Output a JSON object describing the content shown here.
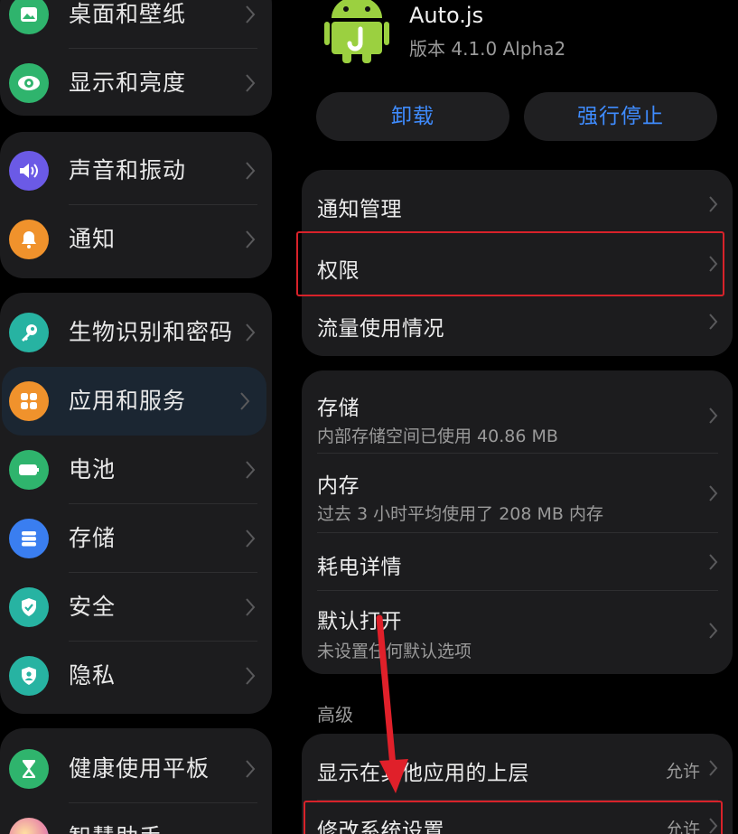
{
  "left_menu": {
    "items": [
      {
        "label": "桌面和壁纸",
        "icon": "wallpaper-icon",
        "color": "#2fb46d"
      },
      {
        "label": "显示和亮度",
        "icon": "eye-icon",
        "color": "#2fb46d"
      },
      {
        "label": "声音和振动",
        "icon": "speaker-icon",
        "color": "#6b5ae6"
      },
      {
        "label": "通知",
        "icon": "bell-icon",
        "color": "#f0922c"
      },
      {
        "label": "生物识别和密码",
        "icon": "key-icon",
        "color": "#27b3a2"
      },
      {
        "label": "应用和服务",
        "icon": "apps-icon",
        "color": "#f0922c"
      },
      {
        "label": "电池",
        "icon": "battery-icon",
        "color": "#2fb46d"
      },
      {
        "label": "存储",
        "icon": "storage-icon",
        "color": "#3a7ef0"
      },
      {
        "label": "安全",
        "icon": "shield-check-icon",
        "color": "#27b3a2"
      },
      {
        "label": "隐私",
        "icon": "privacy-icon",
        "color": "#27b3a2"
      },
      {
        "label": "健康使用平板",
        "icon": "hourglass-icon",
        "color": "#2fb46d"
      },
      {
        "label": "智慧助手",
        "icon": "assistant-icon",
        "color": "#e98aa8"
      }
    ],
    "selected_index": 5
  },
  "app": {
    "name": "Auto.js",
    "version": "版本 4.1.0 Alpha2",
    "icon": "android-js-icon"
  },
  "actions": {
    "uninstall": "卸载",
    "force_stop": "强行停止"
  },
  "card1": {
    "notification": "通知管理",
    "permissions": "权限",
    "data_usage": "流量使用情况"
  },
  "card2": {
    "storage_title": "存储",
    "storage_sub": "内部存储空间已使用 40.86 MB",
    "memory_title": "内存",
    "memory_sub": "过去 3 小时平均使用了 208 MB 内存",
    "power": "耗电详情",
    "default_open_title": "默认打开",
    "default_open_sub": "未设置任何默认选项"
  },
  "advanced": {
    "section_label": "高级",
    "overlay_title": "显示在其他应用的上层",
    "overlay_value": "允许",
    "modify_title": "修改系统设置",
    "modify_value": "允许"
  },
  "colors": {
    "accent": "#3f8cff",
    "highlight": "#d8222a",
    "card": "#1c1c1e"
  }
}
